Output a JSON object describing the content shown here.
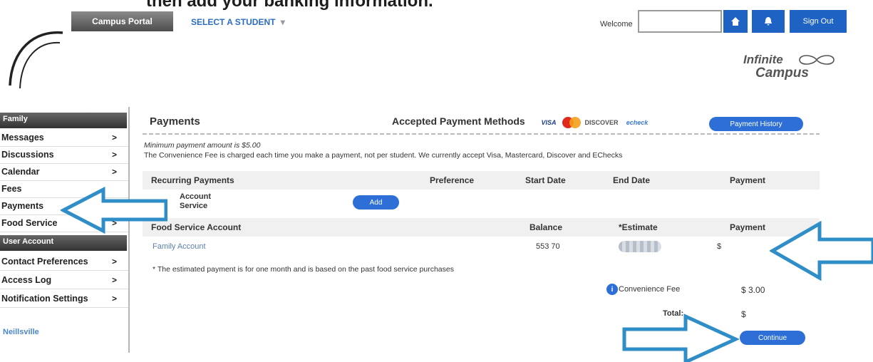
{
  "caption": "then add your banking information.",
  "header": {
    "portal_tab": "Campus Portal",
    "select_student": "SELECT A STUDENT",
    "welcome_label": "Welcome",
    "home_icon": "home-icon",
    "bell_icon": "bell-icon",
    "sign_out": "Sign Out",
    "logo_line1": "Infinite",
    "logo_line2": "Campus"
  },
  "sidebar": {
    "family_header": "Family",
    "user_account_header": "User Account",
    "items": [
      {
        "label": "Messages",
        "chevron": ">"
      },
      {
        "label": "Discussions",
        "chevron": ">"
      },
      {
        "label": "Calendar",
        "chevron": ">"
      },
      {
        "label": "Fees",
        "chevron": ""
      },
      {
        "label": "Payments",
        "chevron": ""
      },
      {
        "label": "Food Service",
        "chevron": ">"
      }
    ],
    "account_items": [
      {
        "label": "Contact Preferences",
        "chevron": ">"
      },
      {
        "label": "Access Log",
        "chevron": ">"
      },
      {
        "label": "Notification Settings",
        "chevron": ">"
      }
    ],
    "district_link": "Neillsville"
  },
  "main": {
    "title": "Payments",
    "methods_label": "Accepted Payment Methods",
    "cards": {
      "visa": "VISA",
      "discover": "DISCOVER",
      "echeck": "echeck"
    },
    "history_button": "Payment History",
    "min_payment": "Minimum payment amount is $5.00",
    "fee_note": "The Convenience Fee is charged each time you make a payment, not per student. We currently accept Visa, Mastercard, Discover and EChecks",
    "recurring": {
      "headers": [
        "Recurring Payments",
        "Preference",
        "Start Date",
        "End Date",
        "Payment"
      ],
      "row_line1": "Account",
      "row_line2": "Service",
      "add_button": "Add"
    },
    "food": {
      "headers": [
        "Food Service Account",
        "Balance",
        "*Estimate",
        "Payment"
      ],
      "row": {
        "account": "Family Account",
        "balance": "553 70",
        "payment": "$"
      }
    },
    "estimate_note": "* The estimated payment is for one month and is based on the past food service purchases",
    "convenience_fee_label": "Convenience Fee",
    "convenience_fee_amount": "$ 3.00",
    "total_label": "Total:",
    "total_amount": "$",
    "submit_button": "Continue",
    "info_icon": "info-icon"
  },
  "colors": {
    "accent": "#2d6fd6",
    "arrow": "#2f8ec8"
  }
}
